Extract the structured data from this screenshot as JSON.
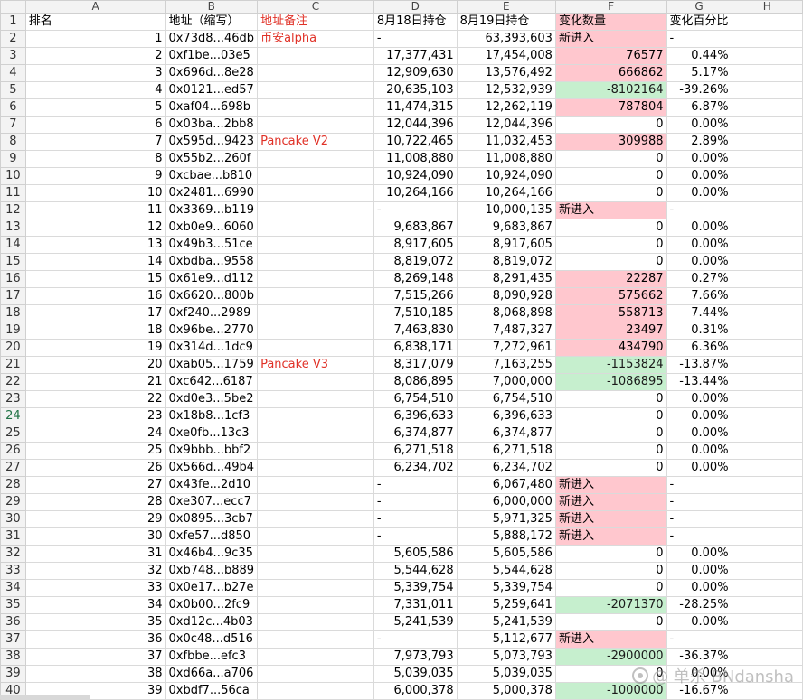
{
  "columns": [
    "A",
    "B",
    "C",
    "D",
    "E",
    "F",
    "G",
    "H"
  ],
  "headers": {
    "rank": "排名",
    "address": "地址（缩写）",
    "note": "地址备注",
    "aug18": "8月18日持仓",
    "aug19": "8月19日持仓",
    "change": "变化数量",
    "pct": "变化百分比"
  },
  "rows": [
    {
      "r": "1",
      "addr": "0x73d8...46db",
      "note": "币安alpha",
      "d18": "-",
      "d19": "63,393,603",
      "chg": "新进入",
      "chgType": "new",
      "pct": "-"
    },
    {
      "r": "2",
      "addr": "0xf1be...03e5",
      "note": "",
      "d18": "17,377,431",
      "d19": "17,454,008",
      "chg": "76577",
      "chgType": "up",
      "pct": "0.44%"
    },
    {
      "r": "3",
      "addr": "0x696d...8e28",
      "note": "",
      "d18": "12,909,630",
      "d19": "13,576,492",
      "chg": "666862",
      "chgType": "up",
      "pct": "5.17%"
    },
    {
      "r": "4",
      "addr": "0x0121...ed57",
      "note": "",
      "d18": "20,635,103",
      "d19": "12,532,939",
      "chg": "-8102164",
      "chgType": "down",
      "pct": "-39.26%"
    },
    {
      "r": "5",
      "addr": "0xaf04...698b",
      "note": "",
      "d18": "11,474,315",
      "d19": "12,262,119",
      "chg": "787804",
      "chgType": "up",
      "pct": "6.87%"
    },
    {
      "r": "6",
      "addr": "0x03ba...2bb8",
      "note": "",
      "d18": "12,044,396",
      "d19": "12,044,396",
      "chg": "0",
      "chgType": "zero",
      "pct": "0.00%"
    },
    {
      "r": "7",
      "addr": "0x595d...9423",
      "note": "Pancake V2",
      "d18": "10,722,465",
      "d19": "11,032,453",
      "chg": "309988",
      "chgType": "up",
      "pct": "2.89%"
    },
    {
      "r": "8",
      "addr": "0x55b2...260f",
      "note": "",
      "d18": "11,008,880",
      "d19": "11,008,880",
      "chg": "0",
      "chgType": "zero",
      "pct": "0.00%"
    },
    {
      "r": "9",
      "addr": "0xcbae...b810",
      "note": "",
      "d18": "10,924,090",
      "d19": "10,924,090",
      "chg": "0",
      "chgType": "zero",
      "pct": "0.00%"
    },
    {
      "r": "10",
      "addr": "0x2481...6990",
      "note": "",
      "d18": "10,264,166",
      "d19": "10,264,166",
      "chg": "0",
      "chgType": "zero",
      "pct": "0.00%"
    },
    {
      "r": "11",
      "addr": "0x3369...b119",
      "note": "",
      "d18": "-",
      "d19": "10,000,135",
      "chg": "新进入",
      "chgType": "new",
      "pct": "-"
    },
    {
      "r": "12",
      "addr": "0xb0e9...6060",
      "note": "",
      "d18": "9,683,867",
      "d19": "9,683,867",
      "chg": "0",
      "chgType": "zero",
      "pct": "0.00%"
    },
    {
      "r": "13",
      "addr": "0x49b3...51ce",
      "note": "",
      "d18": "8,917,605",
      "d19": "8,917,605",
      "chg": "0",
      "chgType": "zero",
      "pct": "0.00%"
    },
    {
      "r": "14",
      "addr": "0xbdba...9558",
      "note": "",
      "d18": "8,819,072",
      "d19": "8,819,072",
      "chg": "0",
      "chgType": "zero",
      "pct": "0.00%"
    },
    {
      "r": "15",
      "addr": "0x61e9...d112",
      "note": "",
      "d18": "8,269,148",
      "d19": "8,291,435",
      "chg": "22287",
      "chgType": "up",
      "pct": "0.27%"
    },
    {
      "r": "16",
      "addr": "0x6620...800b",
      "note": "",
      "d18": "7,515,266",
      "d19": "8,090,928",
      "chg": "575662",
      "chgType": "up",
      "pct": "7.66%"
    },
    {
      "r": "17",
      "addr": "0xf240...2989",
      "note": "",
      "d18": "7,510,185",
      "d19": "8,068,898",
      "chg": "558713",
      "chgType": "up",
      "pct": "7.44%"
    },
    {
      "r": "18",
      "addr": "0x96be...2770",
      "note": "",
      "d18": "7,463,830",
      "d19": "7,487,327",
      "chg": "23497",
      "chgType": "up",
      "pct": "0.31%"
    },
    {
      "r": "19",
      "addr": "0x314d...1dc9",
      "note": "",
      "d18": "6,838,171",
      "d19": "7,272,961",
      "chg": "434790",
      "chgType": "up",
      "pct": "6.36%"
    },
    {
      "r": "20",
      "addr": "0xab05...1759",
      "note": "Pancake V3",
      "d18": "8,317,079",
      "d19": "7,163,255",
      "chg": "-1153824",
      "chgType": "down",
      "pct": "-13.87%"
    },
    {
      "r": "21",
      "addr": "0xc642...6187",
      "note": "",
      "d18": "8,086,895",
      "d19": "7,000,000",
      "chg": "-1086895",
      "chgType": "down",
      "pct": "-13.44%"
    },
    {
      "r": "22",
      "addr": "0xd0e3...5be2",
      "note": "",
      "d18": "6,754,510",
      "d19": "6,754,510",
      "chg": "0",
      "chgType": "zero",
      "pct": "0.00%"
    },
    {
      "r": "23",
      "addr": "0x18b8...1cf3",
      "note": "",
      "d18": "6,396,633",
      "d19": "6,396,633",
      "chg": "0",
      "chgType": "zero",
      "pct": "0.00%"
    },
    {
      "r": "24",
      "addr": "0xe0fb...13c3",
      "note": "",
      "d18": "6,374,877",
      "d19": "6,374,877",
      "chg": "0",
      "chgType": "zero",
      "pct": "0.00%"
    },
    {
      "r": "25",
      "addr": "0x9bbb...bbf2",
      "note": "",
      "d18": "6,271,518",
      "d19": "6,271,518",
      "chg": "0",
      "chgType": "zero",
      "pct": "0.00%"
    },
    {
      "r": "26",
      "addr": "0x566d...49b4",
      "note": "",
      "d18": "6,234,702",
      "d19": "6,234,702",
      "chg": "0",
      "chgType": "zero",
      "pct": "0.00%"
    },
    {
      "r": "27",
      "addr": "0x43fe...2d10",
      "note": "",
      "d18": "-",
      "d19": "6,067,480",
      "chg": "新进入",
      "chgType": "new",
      "pct": "-"
    },
    {
      "r": "28",
      "addr": "0xe307...ecc7",
      "note": "",
      "d18": "-",
      "d19": "6,000,000",
      "chg": "新进入",
      "chgType": "new",
      "pct": "-"
    },
    {
      "r": "29",
      "addr": "0x0895...3cb7",
      "note": "",
      "d18": "-",
      "d19": "5,971,325",
      "chg": "新进入",
      "chgType": "new",
      "pct": "-"
    },
    {
      "r": "30",
      "addr": "0xfe57...d850",
      "note": "",
      "d18": "-",
      "d19": "5,888,172",
      "chg": "新进入",
      "chgType": "new",
      "pct": "-"
    },
    {
      "r": "31",
      "addr": "0x46b4...9c35",
      "note": "",
      "d18": "5,605,586",
      "d19": "5,605,586",
      "chg": "0",
      "chgType": "zero",
      "pct": "0.00%"
    },
    {
      "r": "32",
      "addr": "0xb748...b889",
      "note": "",
      "d18": "5,544,628",
      "d19": "5,544,628",
      "chg": "0",
      "chgType": "zero",
      "pct": "0.00%"
    },
    {
      "r": "33",
      "addr": "0x0e17...b27e",
      "note": "",
      "d18": "5,339,754",
      "d19": "5,339,754",
      "chg": "0",
      "chgType": "zero",
      "pct": "0.00%"
    },
    {
      "r": "34",
      "addr": "0x0b00...2fc9",
      "note": "",
      "d18": "7,331,011",
      "d19": "5,259,641",
      "chg": "-2071370",
      "chgType": "down",
      "pct": "-28.25%"
    },
    {
      "r": "35",
      "addr": "0xd12c...4b03",
      "note": "",
      "d18": "5,241,539",
      "d19": "5,241,539",
      "chg": "0",
      "chgType": "zero",
      "pct": "0.00%"
    },
    {
      "r": "36",
      "addr": "0x0c48...d516",
      "note": "",
      "d18": "-",
      "d19": "5,112,677",
      "chg": "新进入",
      "chgType": "new",
      "pct": "-"
    },
    {
      "r": "37",
      "addr": "0xfbbe...efc3",
      "note": "",
      "d18": "7,973,793",
      "d19": "5,073,793",
      "chg": "-2900000",
      "chgType": "down",
      "pct": "-36.37%"
    },
    {
      "r": "38",
      "addr": "0xd66a...a706",
      "note": "",
      "d18": "5,039,035",
      "d19": "5,039,035",
      "chg": "0",
      "chgType": "zero",
      "pct": "0.00%"
    },
    {
      "r": "39",
      "addr": "0xbdf7...56ca",
      "note": "",
      "d18": "6,000,378",
      "d19": "5,000,378",
      "chg": "-1000000",
      "chgType": "down",
      "pct": "-16.67%"
    }
  ],
  "watermark": "@ 单杀 BNdansha",
  "watermark_icon": "watermark-logo-icon",
  "colors": {
    "increase_fill": "#ffc7ce",
    "decrease_fill": "#c6efce",
    "decrease_text": "#006100",
    "increase_text": "#9c0006",
    "note_text": "#e03127"
  }
}
